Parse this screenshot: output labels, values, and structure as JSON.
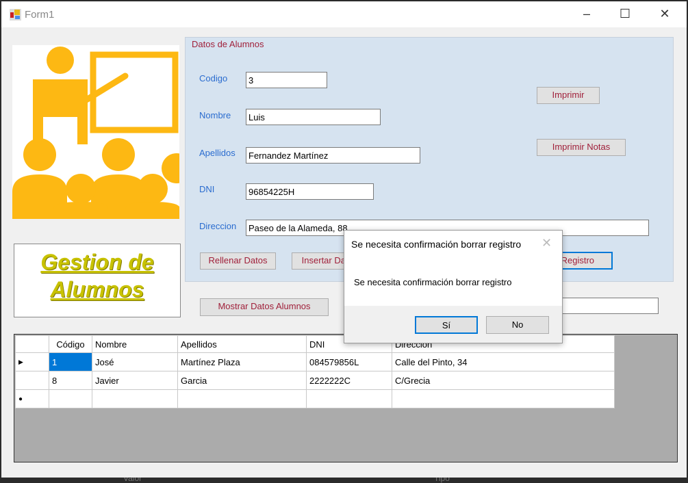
{
  "window": {
    "title": "Form1"
  },
  "logo": {
    "caption_line1": "Gestion de",
    "caption_line2": "Alumnos"
  },
  "group": {
    "title": "Datos de Alumnos",
    "fields": {
      "codigo_label": "Codigo",
      "codigo": "3",
      "nombre_label": "Nombre",
      "nombre": "Luis",
      "apellidos_label": "Apellidos",
      "apellidos": "Fernandez Martínez",
      "dni_label": "DNI",
      "dni": "96854225H",
      "direccion_label": "Direccion",
      "direccion": "Paseo de la Alameda, 88"
    },
    "buttons": {
      "imprimir": "Imprimir",
      "imprimir_notas": "Imprimir Notas",
      "rellenar": "Rellenar Datos",
      "insertar": "Insertar Datos",
      "borrar": "Borrar Registro"
    }
  },
  "mostrar": "Mostrar Datos Alumnos",
  "table": {
    "columns": [
      "Código",
      "Nombre",
      "Apellidos",
      "DNI",
      "Direccion"
    ],
    "rows": [
      [
        "1",
        "José",
        "Martínez Plaza",
        "084579856L",
        "Calle del Pinto, 34"
      ],
      [
        "8",
        "Javier",
        "Garcia",
        "2222222C",
        "C/Grecia"
      ]
    ]
  },
  "dialog": {
    "title": "Se necesita confirmación borrar registro",
    "message": "Se necesita confirmación borrar registro",
    "yes": "Sí",
    "no": "No"
  },
  "background": {
    "text1": "Valor",
    "text2": "Tipo"
  },
  "colors": {
    "accent": "#0078d7",
    "label": "#2a6ccf",
    "button_text": "#a0203a",
    "logo": "#fdb813"
  }
}
